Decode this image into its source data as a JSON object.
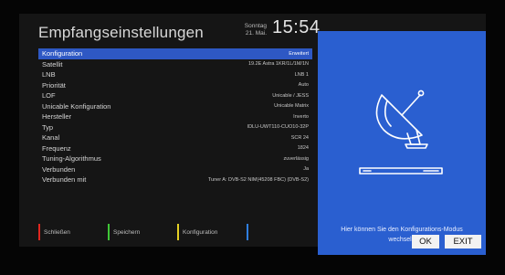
{
  "header": {
    "title": "Empfangseinstellungen",
    "weekday": "Sonntag",
    "date": "21. Mai.",
    "time": "15:54"
  },
  "settings": [
    {
      "label": "Konfiguration",
      "value": "Erweitert",
      "selected": true
    },
    {
      "label": "Satellit",
      "value": "19.2E Astra 1KR/1L/1M/1N"
    },
    {
      "label": "LNB",
      "value": "LNB 1"
    },
    {
      "label": "Priorität",
      "value": "Auto"
    },
    {
      "label": "LOF",
      "value": "Unicable / JESS"
    },
    {
      "label": "Unicable Konfiguration",
      "value": "Unicable Matrix"
    },
    {
      "label": "Hersteller",
      "value": "Inverto"
    },
    {
      "label": "Typ",
      "value": "IDLU-UWT110-CUO10-32P"
    },
    {
      "label": "Kanal",
      "value": "SCR 24"
    },
    {
      "label": "Frequenz",
      "value": "1824"
    },
    {
      "label": "Tuning-Algorithmus",
      "value": "zuverlässig"
    },
    {
      "label": "Verbunden",
      "value": "Ja"
    },
    {
      "label": "Verbunden mit",
      "value": "Tuner A: DVB-S2 NIM(45208 FBC) (DVB-S2)"
    }
  ],
  "info": {
    "help_text": "Hier können Sie den Konfigurations-Modus wechseln",
    "ok_label": "OK",
    "exit_label": "EXIT",
    "icon": "satellite-dish-receiver-icon"
  },
  "footer": {
    "keys": [
      {
        "label": "Schließen",
        "color": "#e0261f"
      },
      {
        "label": "Speichern",
        "color": "#3ec637"
      },
      {
        "label": "Konfiguration",
        "color": "#e4cf23"
      },
      {
        "label": "",
        "color": "#2f7fe0"
      }
    ]
  },
  "colors": {
    "accent": "#2e58c4",
    "info_panel": "#2a5fd0"
  }
}
